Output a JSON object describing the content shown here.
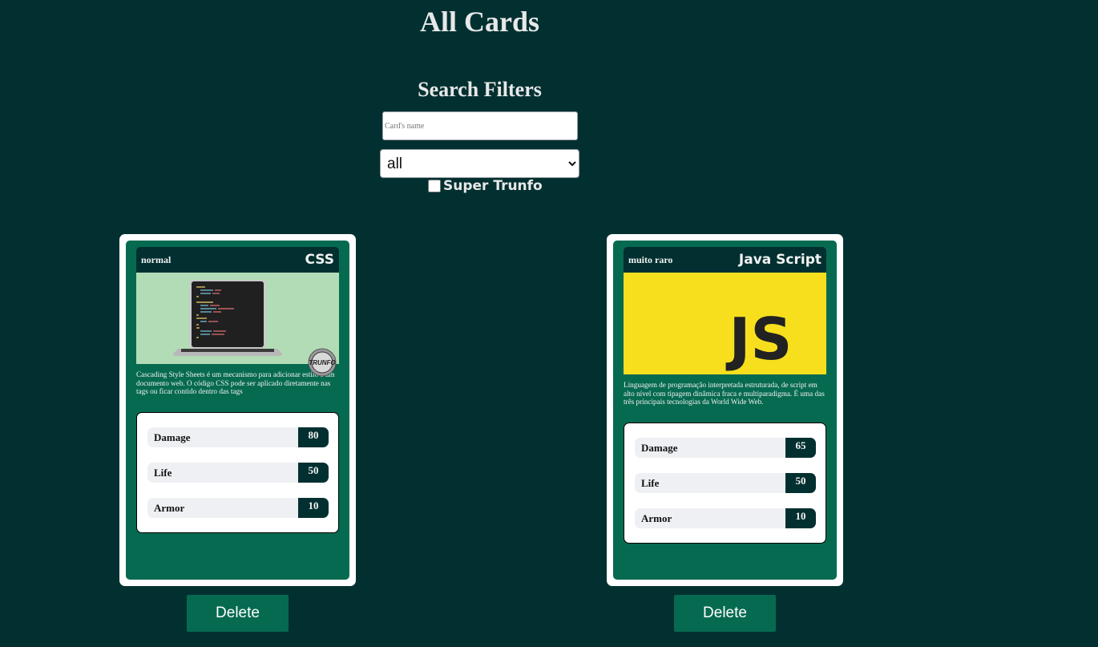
{
  "header": {
    "title": "All Cards"
  },
  "filters": {
    "title": "Search Filters",
    "name_placeholder": "Card's name",
    "rarity_value": "all",
    "trunfo_label": "Super Trunfo"
  },
  "cards": [
    {
      "rarity": "normal",
      "name": "CSS",
      "description": "Cascading Style Sheets é um mecanismo para adicionar estilo a um documento web. O código CSS pode ser aplicado diretamente nas tags ou ficar contido dentro das tags",
      "super_trunfo": true,
      "badge_text": "TRUNFO",
      "attrs": [
        {
          "label": "Damage",
          "value": "80"
        },
        {
          "label": "Life",
          "value": "50"
        },
        {
          "label": "Armor",
          "value": "10"
        }
      ],
      "delete_label": "Delete",
      "image": {
        "bg": "#b2dcb6",
        "icon": "laptop-code-icon"
      }
    },
    {
      "rarity": "muito raro",
      "name": "Java Script",
      "description": "Linguagem de programação interpretada estruturada, de script em alto nível com tipagem dinâmica fraca e multiparadigma. É uma das três principais tecnologias da World Wide Web.",
      "super_trunfo": false,
      "logo_text": "JS",
      "attrs": [
        {
          "label": "Damage",
          "value": "65"
        },
        {
          "label": "Life",
          "value": "50"
        },
        {
          "label": "Armor",
          "value": "10"
        }
      ],
      "delete_label": "Delete",
      "image": {
        "bg": "#f7df1e",
        "icon": "js-logo-icon"
      }
    }
  ],
  "colors": {
    "page_bg": "#023031",
    "card_inner": "#066a50",
    "stat_value_bg": "#023031",
    "button_bg": "#066a50"
  }
}
